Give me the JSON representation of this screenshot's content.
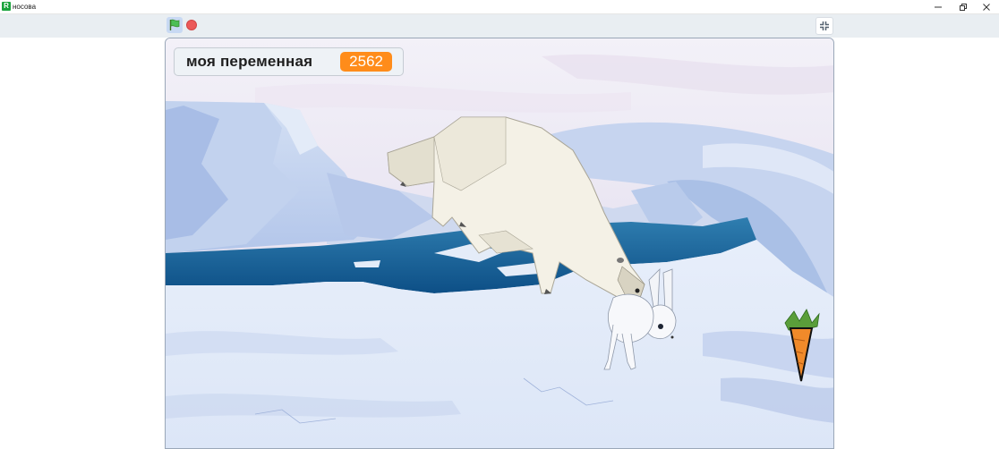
{
  "window": {
    "title": "носова",
    "icon_letter": "R",
    "buttons": [
      "minimize-icon",
      "restore-icon",
      "close-icon"
    ]
  },
  "controls": {
    "green_flag": "green-flag-icon",
    "stop": "stop-icon",
    "fullscreen": "exit-fullscreen-icon"
  },
  "variable_monitor": {
    "label": "моя переменная",
    "value": "2562"
  },
  "scene": {
    "backdrop": "arctic",
    "sprites": [
      "polar-bear",
      "arctic-hare",
      "carrot"
    ]
  },
  "colors": {
    "flag_button_bg": "#c8d9f3",
    "stop_red": "#ec5959",
    "monitor_value_bg": "#ff8c1a",
    "app_green": "#1aa33c"
  }
}
